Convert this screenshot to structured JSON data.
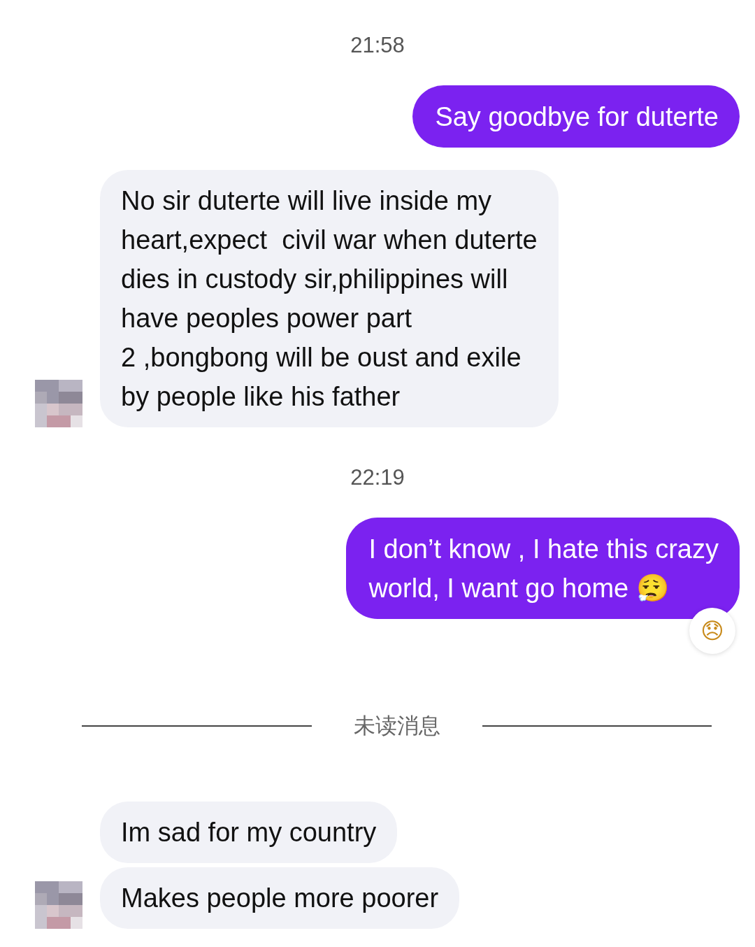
{
  "messages": [
    {
      "kind": "time",
      "text": "21:58"
    },
    {
      "kind": "sent",
      "lines": [
        "Say goodbye for duterte"
      ]
    },
    {
      "kind": "received",
      "bubbles": [
        {
          "lines": [
            "No sir duterte will live inside my",
            "heart,expect  civil war when duterte",
            "dies in custody sir,philippines will",
            "have peoples power part",
            "2 ,bongbong will be oust and exile",
            "by people like his father"
          ]
        }
      ]
    },
    {
      "kind": "time",
      "text": "22:19"
    },
    {
      "kind": "sent",
      "lines": [
        "I don’t know , I hate this crazy",
        "world, I want go home 😮‍💨"
      ],
      "reaction": "😞"
    },
    {
      "kind": "divider",
      "text": "未读消息"
    },
    {
      "kind": "received",
      "bubbles": [
        {
          "lines": [
            "Im sad for my country"
          ]
        },
        {
          "lines": [
            "Makes people more poorer"
          ]
        }
      ]
    }
  ]
}
